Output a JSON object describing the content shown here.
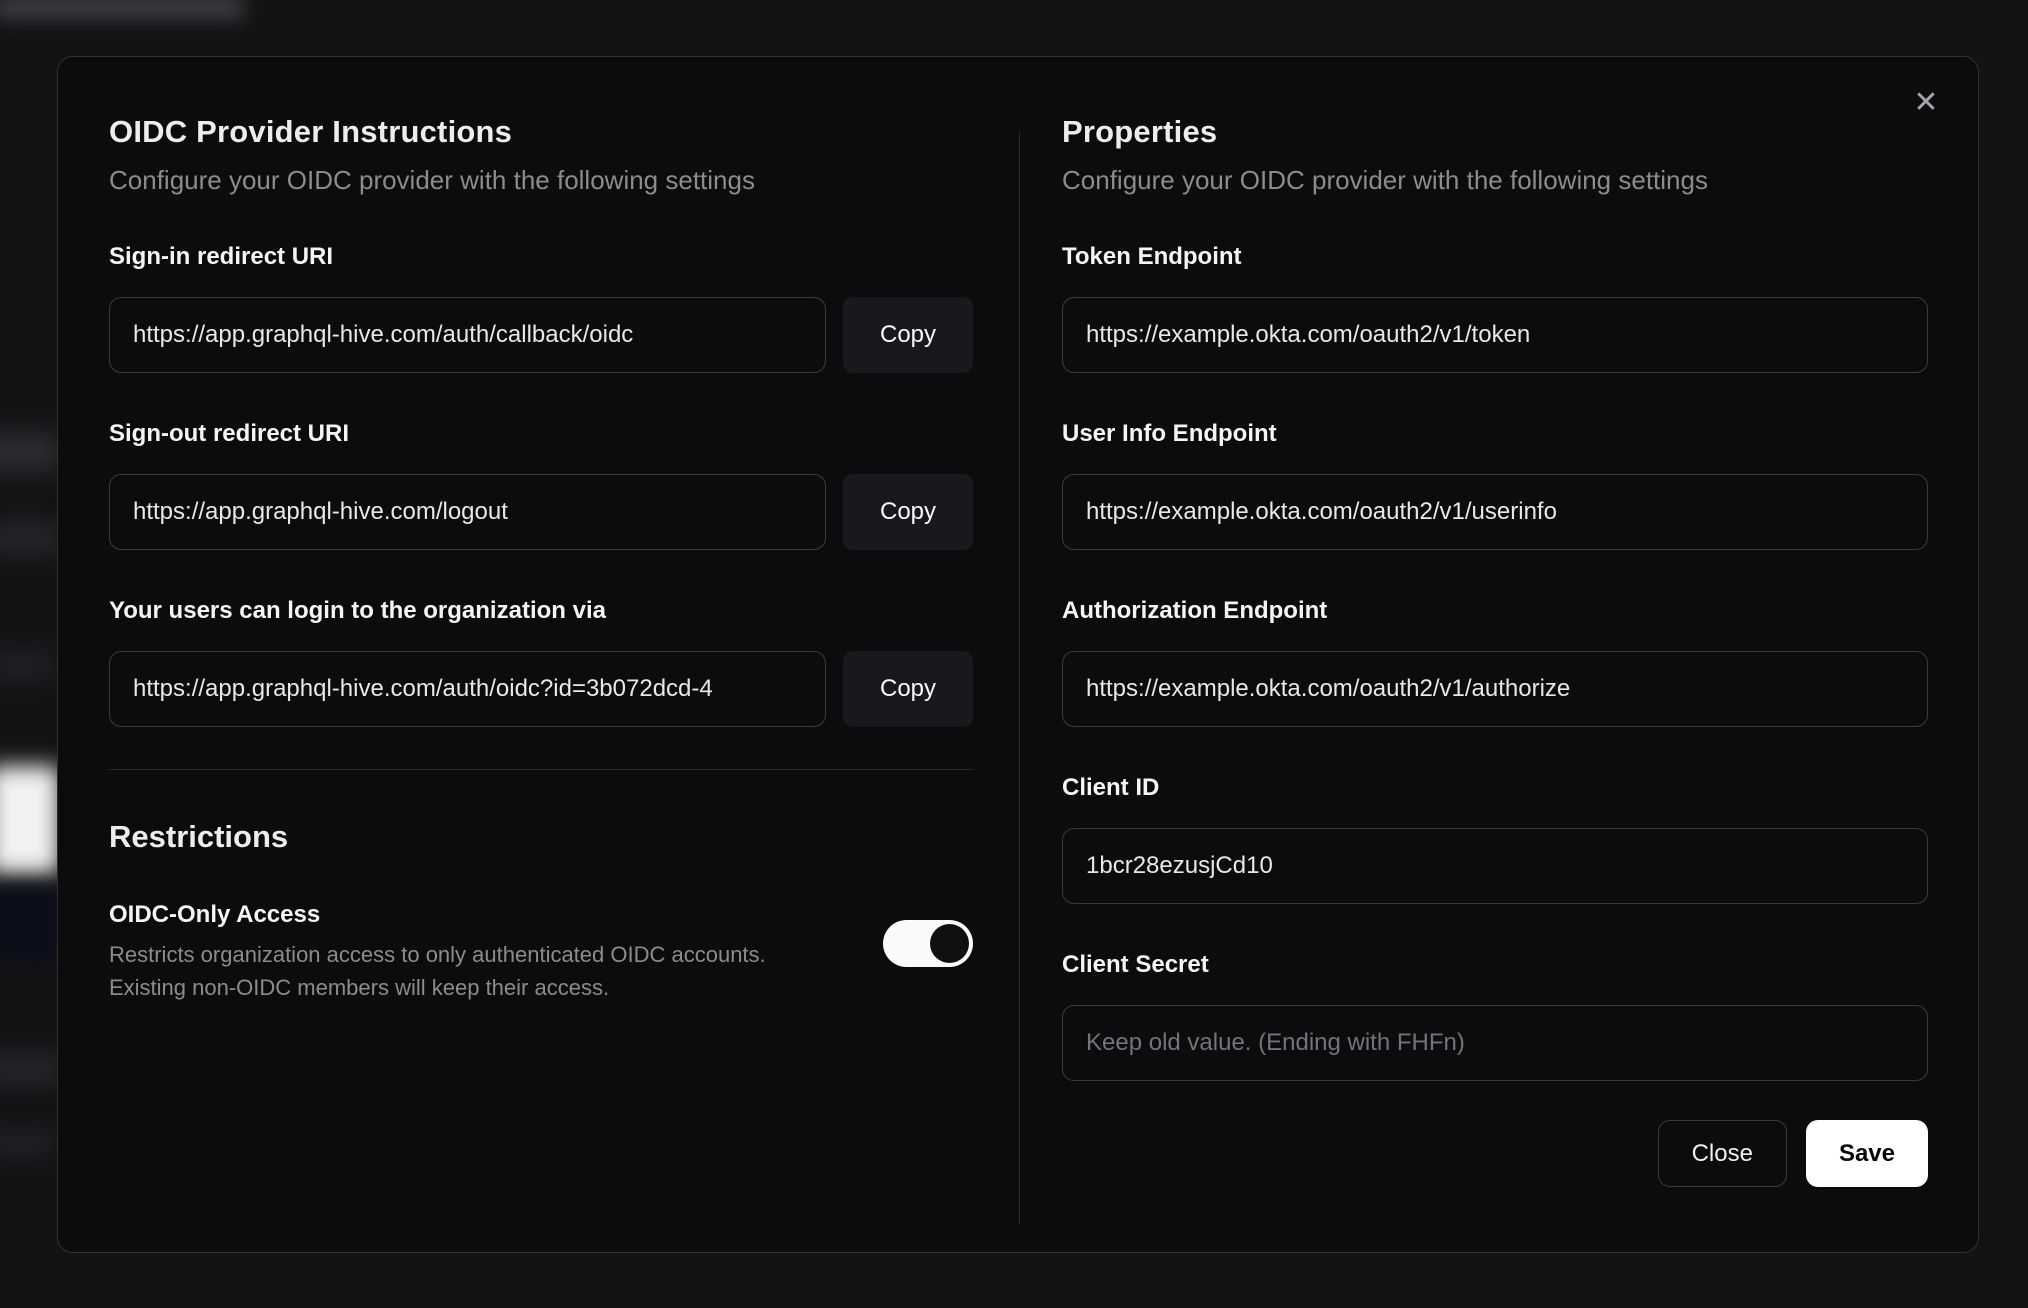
{
  "modal": {
    "close_icon": "✕",
    "left": {
      "title": "OIDC Provider Instructions",
      "subtitle": "Configure your OIDC provider with the following settings",
      "fields": [
        {
          "label": "Sign-in redirect URI",
          "value": "https://app.graphql-hive.com/auth/callback/oidc",
          "copy_label": "Copy"
        },
        {
          "label": "Sign-out redirect URI",
          "value": "https://app.graphql-hive.com/logout",
          "copy_label": "Copy"
        },
        {
          "label": "Your users can login to the organization via",
          "value": "https://app.graphql-hive.com/auth/oidc?id=3b072dcd-4",
          "copy_label": "Copy"
        }
      ],
      "restrictions": {
        "title": "Restrictions",
        "toggle_label": "OIDC-Only Access",
        "description_line1": "Restricts organization access to only authenticated OIDC accounts.",
        "description_line2": "Existing non-OIDC members will keep their access.",
        "toggle_on": true
      }
    },
    "right": {
      "title": "Properties",
      "subtitle": "Configure your OIDC provider with the following settings",
      "fields": [
        {
          "label": "Token Endpoint",
          "value": "https://example.okta.com/oauth2/v1/token"
        },
        {
          "label": "User Info Endpoint",
          "value": "https://example.okta.com/oauth2/v1/userinfo"
        },
        {
          "label": "Authorization Endpoint",
          "value": "https://example.okta.com/oauth2/v1/authorize"
        },
        {
          "label": "Client ID",
          "value": "1bcr28ezusjCd10"
        },
        {
          "label": "Client Secret",
          "value": "",
          "placeholder": "Keep old value. (Ending with FHFn)"
        }
      ],
      "buttons": {
        "close": "Close",
        "save": "Save"
      }
    }
  },
  "colors": {
    "modal_background": "#0c0c0e",
    "page_background": "#131316",
    "input_border": "#3c3c40",
    "copy_button_background": "#19191d",
    "accent_button_background": "#ffffff",
    "muted_text": "#8f8b86",
    "toggle_track_on": "#fafafa"
  }
}
